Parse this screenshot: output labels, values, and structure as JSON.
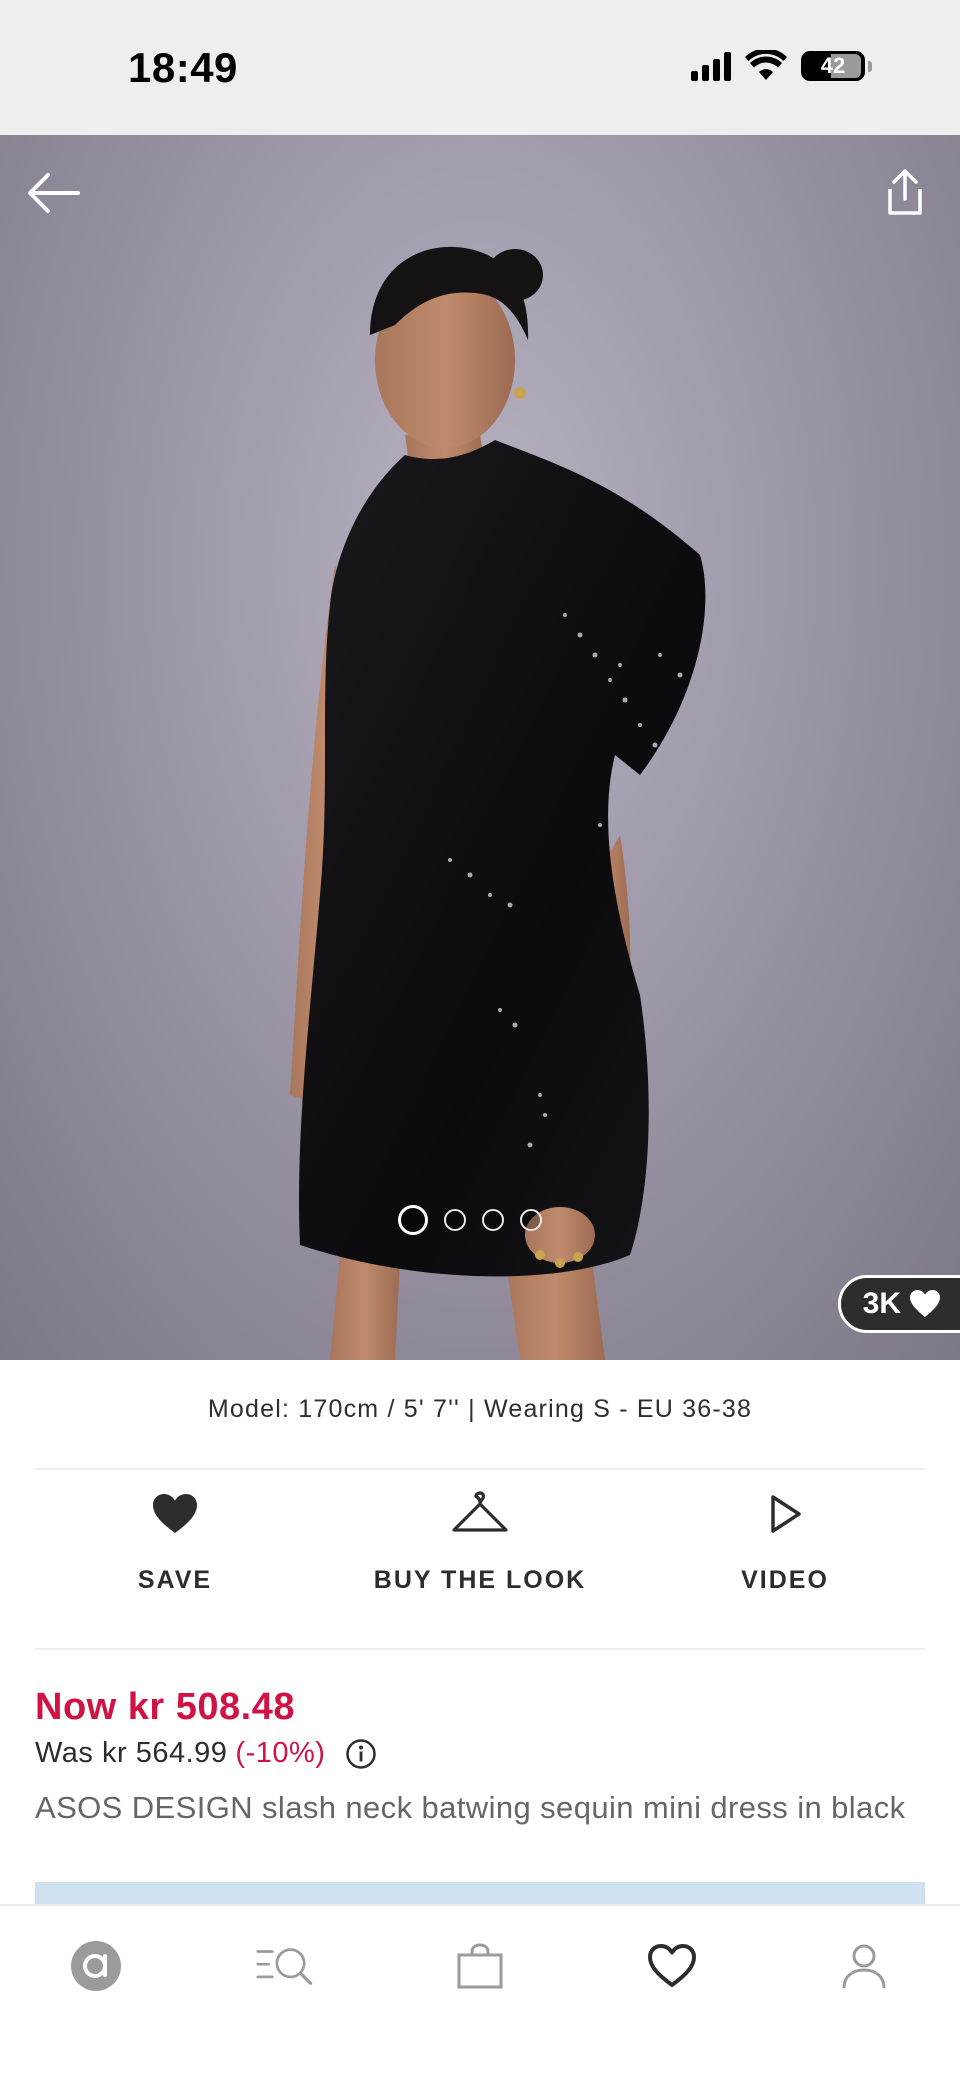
{
  "status_bar": {
    "time": "18:49",
    "battery_level": "42"
  },
  "product": {
    "likes": "3K",
    "model_info": "Model: 170cm / 5' 7'' | Wearing S - EU 36-38",
    "price_now": "Now kr 508.48",
    "price_was": "Was kr 564.99",
    "discount": "(-10%)",
    "name": "ASOS DESIGN slash neck batwing sequin mini dress in black",
    "image_count": 4,
    "active_image": 1
  },
  "actions": {
    "save_label": "SAVE",
    "buy_the_look_label": "BUY THE LOOK",
    "video_label": "VIDEO"
  },
  "icons": {
    "back": "arrow-left-icon",
    "share": "share-icon",
    "save": "heart-filled-icon",
    "buy_the_look": "hanger-icon",
    "video": "play-icon",
    "info": "info-icon",
    "nav_home": "asos-logo-icon",
    "nav_search": "search-icon",
    "nav_bag": "bag-icon",
    "nav_saved": "heart-outline-icon",
    "nav_account": "account-icon"
  },
  "colors": {
    "accent": "#d01345",
    "text": "#2d2d2d",
    "status_bg": "#eeeeee",
    "banner": "#cfe0f3"
  }
}
